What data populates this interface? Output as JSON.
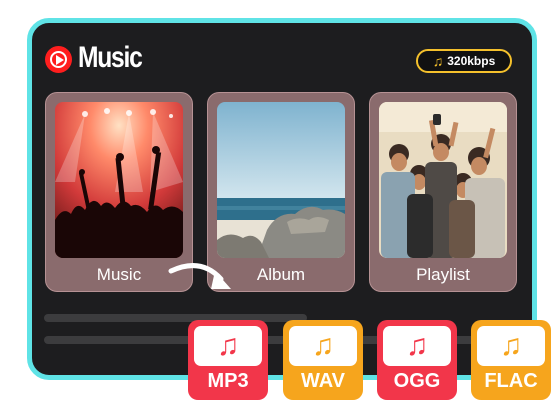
{
  "app": {
    "title": "Music"
  },
  "badge": {
    "label": "320kbps",
    "icon": "music-note-icon"
  },
  "tiles": [
    {
      "label": "Music"
    },
    {
      "label": "Album"
    },
    {
      "label": "Playlist"
    }
  ],
  "formats": [
    {
      "label": "MP3",
      "color": "#f2364a"
    },
    {
      "label": "WAV",
      "color": "#f6a51d"
    },
    {
      "label": "OGG",
      "color": "#f2364a"
    },
    {
      "label": "FLAC",
      "color": "#f6a51d"
    }
  ],
  "colors": {
    "frame_border": "#5fe3e6",
    "panel": "#1d1d1f",
    "badge_border": "#f5c12c",
    "logo": "#ff1e1e"
  }
}
